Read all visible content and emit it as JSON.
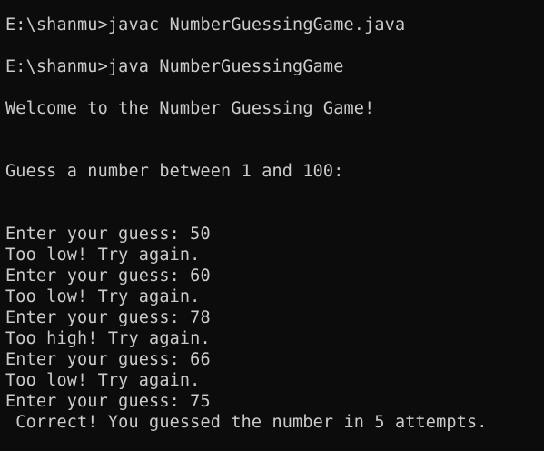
{
  "terminal": {
    "lines": [
      "E:\\shanmu>javac NumberGuessingGame.java",
      "E:\\shanmu>java NumberGuessingGame",
      "Welcome to the Number Guessing Game!",
      "Guess a number between 1 and 100:",
      "Enter your guess: 50",
      "Too low! Try again.",
      "Enter your guess: 60",
      "Too low! Try again.",
      "Enter your guess: 78",
      "Too high! Try again.",
      "Enter your guess: 66",
      "Too low! Try again.",
      "Enter your guess: 75",
      " Correct! You guessed the number in 5 attempts."
    ]
  }
}
